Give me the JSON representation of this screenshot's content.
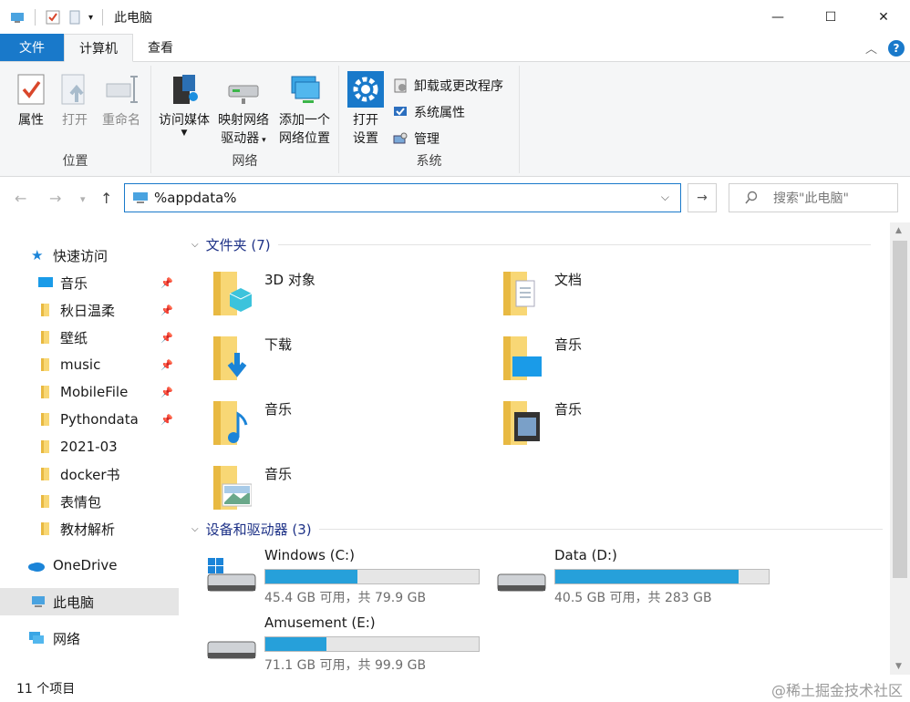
{
  "window": {
    "title": "此电脑",
    "minimize": "—",
    "maximize": "☐",
    "close": "✕"
  },
  "tabs": {
    "file": "文件",
    "computer": "计算机",
    "view": "查看"
  },
  "ribbon": {
    "location": {
      "label": "位置",
      "properties": "属性",
      "open": "打开",
      "rename": "重命名"
    },
    "network": {
      "label": "网络",
      "access_media": "访问媒体",
      "map_drive_1": "映射网络",
      "map_drive_2": "驱动器",
      "add_location_1": "添加一个",
      "add_location_2": "网络位置"
    },
    "system": {
      "label": "系统",
      "open_settings_1": "打开",
      "open_settings_2": "设置",
      "uninstall": "卸载或更改程序",
      "sys_props": "系统属性",
      "manage": "管理"
    }
  },
  "address": {
    "value": "%appdata%",
    "search_placeholder": "搜索\"此电脑\""
  },
  "nav": {
    "quick_access": "快速访问",
    "items": [
      "音乐",
      "秋日温柔",
      "壁纸",
      "music",
      "MobileFile",
      "Pythondata",
      "2021-03",
      "docker书",
      "表情包",
      "教材解析"
    ],
    "onedrive": "OneDrive",
    "this_pc": "此电脑",
    "network": "网络"
  },
  "folders_section": {
    "title": "文件夹 (7)"
  },
  "folders": [
    "3D 对象",
    "文档",
    "下载",
    "音乐",
    "音乐",
    "音乐",
    "音乐"
  ],
  "drives_section": {
    "title": "设备和驱动器 (3)"
  },
  "drives": [
    {
      "name": "Windows (C:)",
      "info": "45.4 GB 可用，共 79.9 GB",
      "used_fraction": 0.432
    },
    {
      "name": "Data (D:)",
      "info": "40.5 GB 可用，共 283 GB",
      "used_fraction": 0.857
    },
    {
      "name": "Amusement (E:)",
      "info": "71.1 GB 可用，共 99.9 GB",
      "used_fraction": 0.288
    }
  ],
  "status": {
    "count": "11 个项目",
    "watermark": "@稀土掘金技术社区"
  },
  "colors": {
    "accent": "#1979ca",
    "bar_fill": "#26a0da",
    "folder": "#f8d775"
  }
}
